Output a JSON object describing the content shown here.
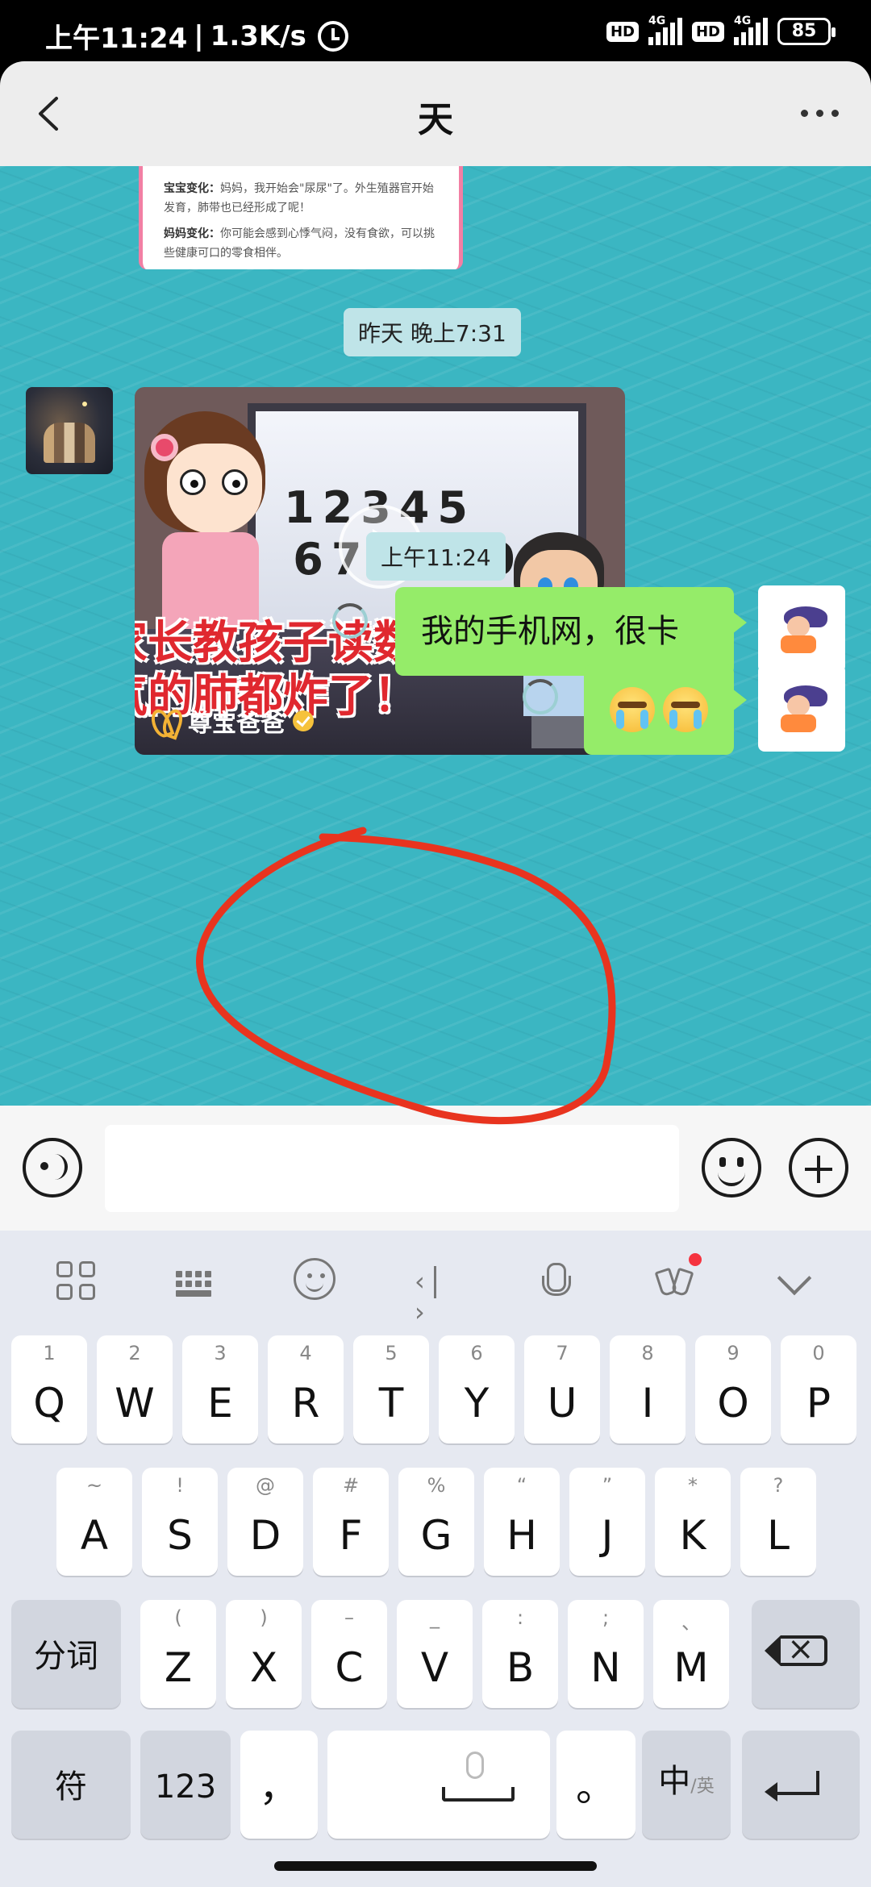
{
  "status_bar": {
    "time": "上午11:24",
    "speed": "1.3K/s",
    "separator": "|",
    "hd_label": "HD",
    "network_label": "4G",
    "battery": "85"
  },
  "header": {
    "title": "天"
  },
  "chat": {
    "previous_card_lines": [
      {
        "label": "宝宝变化：",
        "text": "妈妈，我开始会\"尿尿\"了。外生殖器官开始发育，肺带也已经形成了呢！"
      },
      {
        "label": "妈妈变化：",
        "text": "你可能会感到心悸气闷，没有食欲，可以挑些健康可口的零食相伴。"
      }
    ],
    "timestamp_1": "昨天 晚上7:31",
    "video": {
      "numbers_row_1": "12345",
      "numbers_row_2": "678910",
      "caption_line_1": "家长教孩子读数字",
      "caption_line_2": "气的肺都炸了！",
      "brand": "尊宝爸爸"
    },
    "timestamp_2": "上午11:24",
    "message_1": "我的手机网，很卡",
    "message_2_emojis": [
      "crying-face",
      "crying-face"
    ]
  },
  "annotation_color": "#e8341f",
  "keyboard": {
    "row1": [
      {
        "key": "Q",
        "sub": "1"
      },
      {
        "key": "W",
        "sub": "2"
      },
      {
        "key": "E",
        "sub": "3"
      },
      {
        "key": "R",
        "sub": "4"
      },
      {
        "key": "T",
        "sub": "5"
      },
      {
        "key": "Y",
        "sub": "6"
      },
      {
        "key": "U",
        "sub": "7"
      },
      {
        "key": "I",
        "sub": "8"
      },
      {
        "key": "O",
        "sub": "9"
      },
      {
        "key": "P",
        "sub": "0"
      }
    ],
    "row2": [
      {
        "key": "A",
        "sub": "~"
      },
      {
        "key": "S",
        "sub": "!"
      },
      {
        "key": "D",
        "sub": "@"
      },
      {
        "key": "F",
        "sub": "#"
      },
      {
        "key": "G",
        "sub": "%"
      },
      {
        "key": "H",
        "sub": "“"
      },
      {
        "key": "J",
        "sub": "”"
      },
      {
        "key": "K",
        "sub": "*"
      },
      {
        "key": "L",
        "sub": "?"
      }
    ],
    "row3": [
      {
        "key": "Z",
        "sub": "("
      },
      {
        "key": "X",
        "sub": ")"
      },
      {
        "key": "C",
        "sub": "–"
      },
      {
        "key": "V",
        "sub": "_"
      },
      {
        "key": "B",
        "sub": ":"
      },
      {
        "key": "N",
        "sub": ";"
      },
      {
        "key": "M",
        "sub": "、"
      }
    ],
    "fenci": "分词",
    "symbols": "符",
    "numbers": "123",
    "comma": "，",
    "period": "。",
    "lang_zh": "中",
    "lang_en": "/英"
  }
}
